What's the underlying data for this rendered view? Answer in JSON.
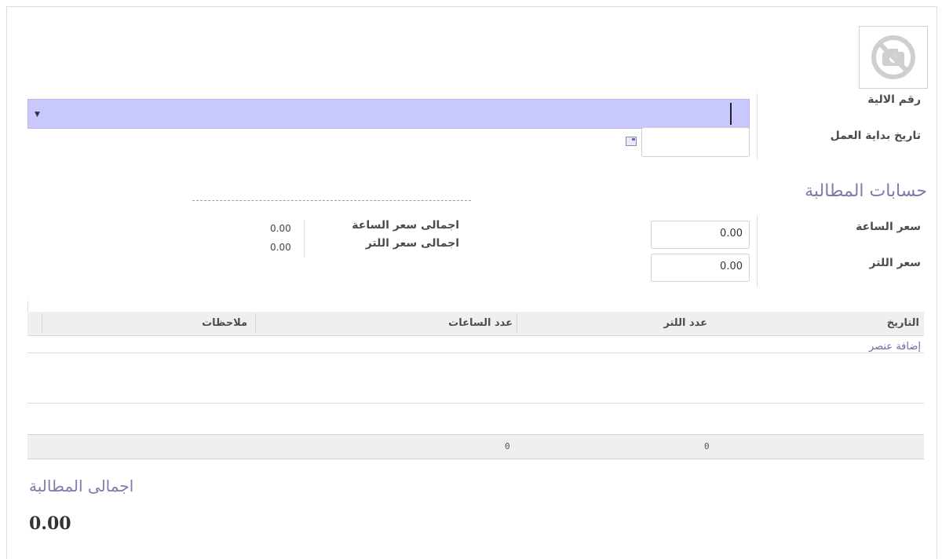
{
  "form": {
    "machine_label": "رقم الالية",
    "start_date_label": "تاريخ بداية العمل",
    "start_date_value": "",
    "machine_value": ""
  },
  "claims": {
    "title": "حسابات المطالبة",
    "hour_price_label": "سعر الساعة",
    "hour_price_value": "0.00",
    "liter_price_label": "سعر اللتر",
    "liter_price_value": "0.00",
    "total_hour_price_label": "اجمالى سعر الساعة",
    "total_hour_price_value": "0.00",
    "total_liter_price_label": "اجمالى سعر اللتر",
    "total_liter_price_value": "0.00"
  },
  "table": {
    "columns": [
      "التاريخ",
      "عدد اللتر",
      "عدد الساعات",
      "ملاحظات"
    ],
    "add_item": "إضافة عنصر",
    "totals": {
      "liters": "0",
      "hours": "0"
    }
  },
  "total": {
    "label": "اجمالى المطالبة",
    "value": "0.00"
  },
  "colors": {
    "accent": "#7c7bad",
    "selected_field": "#c8c8ff"
  }
}
